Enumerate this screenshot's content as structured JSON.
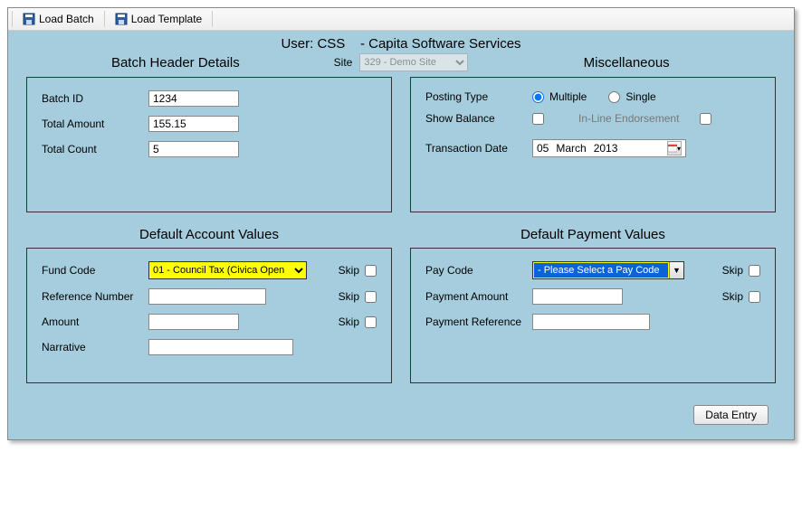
{
  "toolbar": {
    "load_batch": "Load Batch",
    "load_template": "Load Template"
  },
  "header": {
    "user_label": "User: CSS",
    "company": "- Capita Software Services",
    "site_label": "Site",
    "site_value": "329 - Demo Site"
  },
  "sections": {
    "batch_header": "Batch Header Details",
    "miscellaneous": "Miscellaneous",
    "default_account": "Default Account Values",
    "default_payment": "Default Payment Values"
  },
  "batch": {
    "batch_id_label": "Batch ID",
    "batch_id_value": "1234",
    "total_amount_label": "Total Amount",
    "total_amount_value": "155.15",
    "total_count_label": "Total Count",
    "total_count_value": "5"
  },
  "misc": {
    "posting_type_label": "Posting Type",
    "multiple_label": "Multiple",
    "single_label": "Single",
    "posting_type_value": "multiple",
    "show_balance_label": "Show Balance",
    "show_balance_checked": false,
    "inline_endorsement_label": "In-Line Endorsement",
    "inline_endorsement_checked": false,
    "transaction_date_label": "Transaction Date",
    "transaction_date": {
      "day": "05",
      "month": "March",
      "year": "2013"
    }
  },
  "account": {
    "fund_code_label": "Fund Code",
    "fund_code_value": "01 - Council Tax (Civica Open",
    "reference_number_label": "Reference Number",
    "reference_number_value": "",
    "amount_label": "Amount",
    "amount_value": "",
    "narrative_label": "Narrative",
    "narrative_value": ""
  },
  "payment": {
    "pay_code_label": "Pay Code",
    "pay_code_value": "- Please Select a Pay Code",
    "payment_amount_label": "Payment Amount",
    "payment_amount_value": "",
    "payment_reference_label": "Payment Reference",
    "payment_reference_value": ""
  },
  "labels": {
    "skip": "Skip"
  },
  "footer": {
    "data_entry": "Data Entry"
  }
}
